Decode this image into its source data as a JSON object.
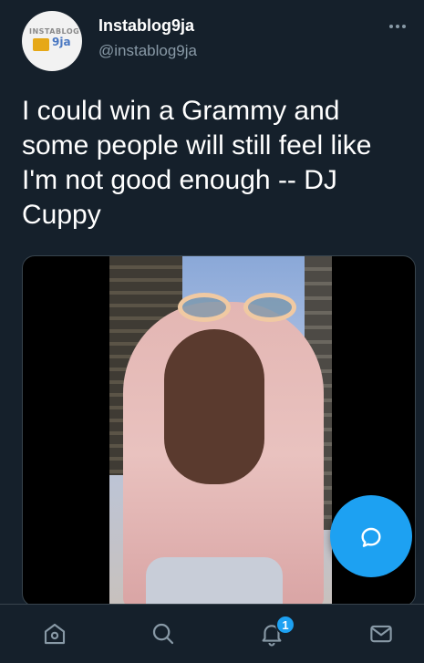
{
  "tweet": {
    "display_name": "Instablog9ja",
    "handle": "@instablog9ja",
    "text": "I could win a Grammy and some people will still feel like I'm not good enough -- DJ Cuppy",
    "avatar_logo_top": "INSTABLOG",
    "avatar_logo_suffix": "9ja"
  },
  "more_icon": "more-horizontal-icon",
  "compose_icon": "chat-bubble-icon",
  "tabbar": {
    "items": [
      {
        "name": "home",
        "icon": "home-icon"
      },
      {
        "name": "search",
        "icon": "search-icon"
      },
      {
        "name": "notifications",
        "icon": "bell-icon",
        "badge": "1"
      },
      {
        "name": "messages",
        "icon": "mail-icon"
      }
    ]
  },
  "colors": {
    "background": "#15202b",
    "accent": "#1da1f2",
    "secondary_text": "#8899a6",
    "border": "#38444d"
  }
}
